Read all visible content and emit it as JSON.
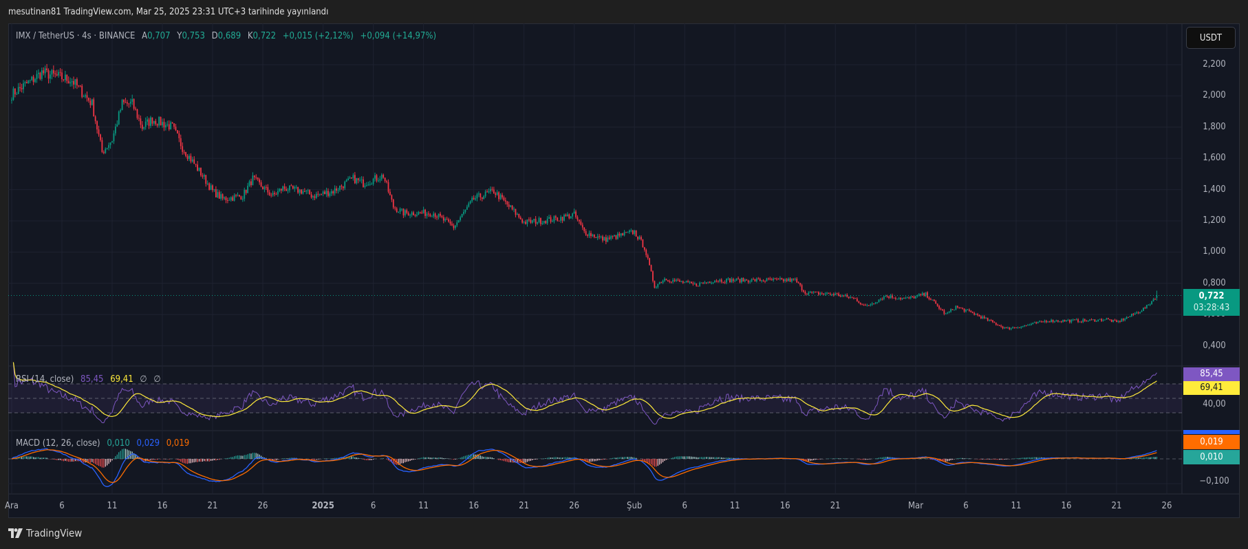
{
  "header": {
    "published": "mesutinan81 TradingView.com, Mar 25, 2025 23:31 UTC+3 tarihinde yayınlandı"
  },
  "symbol": {
    "title": "IMX / TetherUS · 4s · BINANCE",
    "open_label": "A",
    "open": "0,707",
    "high_label": "Y",
    "high": "0,753",
    "low_label": "D",
    "low": "0,689",
    "close_label": "K",
    "close": "0,722",
    "change": "+0,015 (+2,12%)",
    "change2": "+0,094 (+14,97%)"
  },
  "currency_button": "USDT",
  "price_axis": [
    "2,200",
    "2,000",
    "1,800",
    "1,600",
    "1,400",
    "1,200",
    "1,000",
    "0,800",
    "0,600",
    "0,400"
  ],
  "last_price": {
    "value": "0,722",
    "countdown": "03:28:43",
    "color": "#089981"
  },
  "rsi": {
    "legend": "RSI (14, close)",
    "rsi_value": "85,45",
    "ma_value": "69,41",
    "extra1": "∅",
    "extra2": "∅",
    "axis_label": "40,00",
    "rsi_color": "#7e57c2",
    "ma_color": "#ffeb3b",
    "levels": [
      70,
      50,
      30
    ]
  },
  "macd": {
    "legend": "MACD (12, 26, close)",
    "hist_value": "0,010",
    "macd_value": "0,029",
    "signal_value": "0,019",
    "axis_label": "−0,100",
    "macd_color": "#2962ff",
    "signal_color": "#ff6d00",
    "hist_color": "#26a69a"
  },
  "time_axis": [
    {
      "label": "Ara",
      "day": 0
    },
    {
      "label": "6",
      "day": 5
    },
    {
      "label": "11",
      "day": 10
    },
    {
      "label": "16",
      "day": 15
    },
    {
      "label": "21",
      "day": 20
    },
    {
      "label": "26",
      "day": 25
    },
    {
      "label": "2025",
      "day": 31,
      "bold": true
    },
    {
      "label": "6",
      "day": 36
    },
    {
      "label": "11",
      "day": 41
    },
    {
      "label": "16",
      "day": 46
    },
    {
      "label": "21",
      "day": 51
    },
    {
      "label": "26",
      "day": 56
    },
    {
      "label": "Şub",
      "day": 62
    },
    {
      "label": "6",
      "day": 67
    },
    {
      "label": "11",
      "day": 72
    },
    {
      "label": "16",
      "day": 77
    },
    {
      "label": "21",
      "day": 82
    },
    {
      "label": "Mar",
      "day": 90
    },
    {
      "label": "6",
      "day": 95
    },
    {
      "label": "11",
      "day": 100
    },
    {
      "label": "16",
      "day": 105
    },
    {
      "label": "21",
      "day": 110
    },
    {
      "label": "26",
      "day": 115
    }
  ],
  "colors": {
    "up": "#089981",
    "down": "#f23645",
    "background": "#131722"
  },
  "chart_data": {
    "type": "candlestick",
    "interval": "4h",
    "x_unit": "date",
    "y_range": [
      0.35,
      2.3
    ],
    "close_path": [
      [
        "2024-12-01",
        2.01
      ],
      [
        "2024-12-03",
        2.1
      ],
      [
        "2024-12-04",
        2.15
      ],
      [
        "2024-12-07",
        2.1
      ],
      [
        "2024-12-09",
        1.95
      ],
      [
        "2024-12-10",
        1.64
      ],
      [
        "2024-12-11",
        1.72
      ],
      [
        "2024-12-12",
        1.95
      ],
      [
        "2024-12-13",
        1.95
      ],
      [
        "2024-12-14",
        1.8
      ],
      [
        "2024-12-15",
        1.85
      ],
      [
        "2024-12-17",
        1.8
      ],
      [
        "2024-12-18",
        1.67
      ],
      [
        "2024-12-20",
        1.49
      ],
      [
        "2024-12-21",
        1.39
      ],
      [
        "2024-12-22",
        1.34
      ],
      [
        "2024-12-24",
        1.36
      ],
      [
        "2024-12-25",
        1.47
      ],
      [
        "2024-12-27",
        1.36
      ],
      [
        "2024-12-28",
        1.41
      ],
      [
        "2024-12-30",
        1.39
      ],
      [
        "2024-12-31",
        1.36
      ],
      [
        "2025-01-02",
        1.39
      ],
      [
        "2025-01-04",
        1.47
      ],
      [
        "2025-01-05",
        1.44
      ],
      [
        "2025-01-07",
        1.49
      ],
      [
        "2025-01-08",
        1.29
      ],
      [
        "2025-01-09",
        1.25
      ],
      [
        "2025-01-12",
        1.25
      ],
      [
        "2025-01-14",
        1.16
      ],
      [
        "2025-01-16",
        1.34
      ],
      [
        "2025-01-18",
        1.39
      ],
      [
        "2025-01-20",
        1.26
      ],
      [
        "2025-01-21",
        1.19
      ],
      [
        "2025-01-24",
        1.21
      ],
      [
        "2025-01-26",
        1.24
      ],
      [
        "2025-01-27",
        1.13
      ],
      [
        "2025-01-29",
        1.08
      ],
      [
        "2025-02-01",
        1.13
      ],
      [
        "2025-02-02",
        1.03
      ],
      [
        "2025-02-03",
        0.78
      ],
      [
        "2025-02-04",
        0.83
      ],
      [
        "2025-02-07",
        0.79
      ],
      [
        "2025-02-09",
        0.82
      ],
      [
        "2025-02-11",
        0.82
      ],
      [
        "2025-02-14",
        0.82
      ],
      [
        "2025-02-17",
        0.82
      ],
      [
        "2025-02-18",
        0.74
      ],
      [
        "2025-02-21",
        0.73
      ],
      [
        "2025-02-23",
        0.7
      ],
      [
        "2025-02-24",
        0.65
      ],
      [
        "2025-02-26",
        0.72
      ],
      [
        "2025-02-28",
        0.7
      ],
      [
        "2025-03-02",
        0.73
      ],
      [
        "2025-03-04",
        0.6
      ],
      [
        "2025-03-05",
        0.65
      ],
      [
        "2025-03-07",
        0.6
      ],
      [
        "2025-03-10",
        0.51
      ],
      [
        "2025-03-12",
        0.53
      ],
      [
        "2025-03-14",
        0.56
      ],
      [
        "2025-03-18",
        0.56
      ],
      [
        "2025-03-20",
        0.57
      ],
      [
        "2025-03-21",
        0.55
      ],
      [
        "2025-03-23",
        0.61
      ],
      [
        "2025-03-24",
        0.65
      ],
      [
        "2025-03-25",
        0.722
      ]
    ]
  }
}
